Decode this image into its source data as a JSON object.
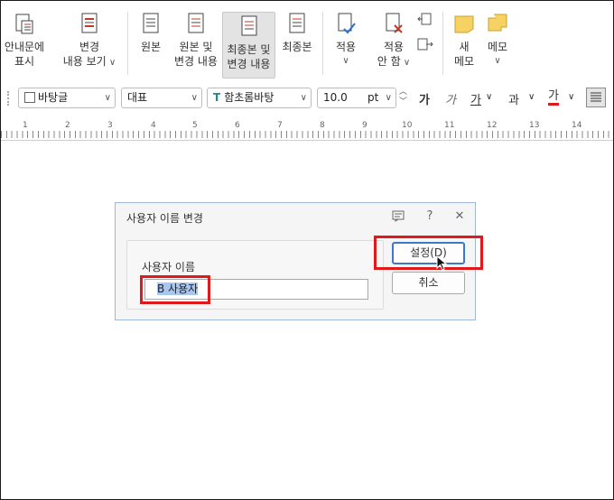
{
  "ribbon": {
    "guide_display": [
      "안내문에",
      "표시"
    ],
    "view_changes": [
      "변경",
      "내용 보기"
    ],
    "original": "원본",
    "original_with_changes": [
      "원본 및",
      "변경 내용"
    ],
    "final_with_changes": [
      "최종본 및",
      "변경 내용"
    ],
    "final": "최종본",
    "apply": "적용",
    "dont_apply": [
      "적용",
      "안 함"
    ],
    "new_memo": [
      "새",
      "메모"
    ],
    "memo": "메모"
  },
  "format_bar": {
    "style": "바탕글",
    "language": "대표",
    "font": "함초롬바탕",
    "size": "10.0",
    "unit": "pt",
    "bold": "가",
    "italic": "가",
    "underline": "가",
    "strike": "과",
    "font_color": "가"
  },
  "ruler": {
    "marks": [
      "1",
      "2",
      "3",
      "4",
      "5",
      "6",
      "7",
      "8",
      "9",
      "10",
      "11",
      "12",
      "13",
      "14"
    ]
  },
  "dialog": {
    "title": "사용자 이름 변경",
    "group_label": "사용자 이름",
    "username_value": "B 사용자",
    "set_button": "설정(D)",
    "cancel_button": "취소"
  },
  "colors": {
    "highlight": "#e01a1a",
    "accent": "#3a78c8",
    "selection": "#a9c6f0"
  },
  "icons": [
    "memo-icon",
    "help-icon",
    "close-icon"
  ]
}
